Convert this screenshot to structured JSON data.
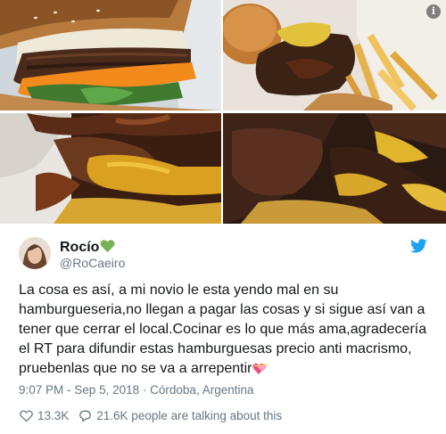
{
  "tweet": {
    "display_name": "Rocío",
    "handle": "@RoCaeiro",
    "body": "La cosa es así, a mi novio le esta yendo mal en su hamburgueseria,no llegan a pagar las cosas y si sigue así van a tener que cerrar el local.Cocinar es lo que más ama,agradecería el RT para difundir estas hamburguesas precio anti macrismo, pruebenlas que no se va a arrepentir",
    "time": "9:07 PM",
    "date": "Sep 5, 2018",
    "location": "Córdoba, Argentina",
    "separator": "·",
    "likes": "13.3K",
    "talking": "21.6K people are talking about this"
  },
  "icons": {
    "info": "info-icon",
    "verified_like": "green-heart-icon",
    "twitter": "twitter-bird-icon",
    "emoji": "heart-with-ribbon-icon",
    "like": "heart-outline-icon",
    "reply": "speech-bubble-icon"
  },
  "info_label": "i",
  "colors": {
    "twitter_blue": "#1da1f2",
    "muted_text": "#657786",
    "main_text": "#14171a",
    "green_heart": "#77b255"
  }
}
